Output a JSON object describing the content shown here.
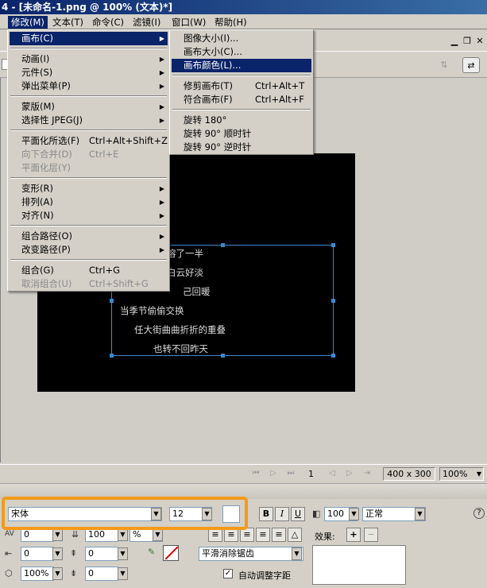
{
  "title": "4 - [未命名-1.png @ 100% (文本)*]",
  "menubar": [
    "修改(M)",
    "文本(T)",
    "命令(C)",
    "滤镜(I)",
    "窗口(W)",
    "帮助(H)"
  ],
  "modify_menu": {
    "items": [
      {
        "label": "画布(C)",
        "submenu": true
      },
      {
        "label": "动画(I)",
        "submenu": true
      },
      {
        "label": "元件(S)",
        "submenu": true
      },
      {
        "label": "弹出菜单(P)",
        "submenu": true
      },
      {
        "label": "蒙版(M)",
        "submenu": true
      },
      {
        "label": "选择性 JPEG(J)",
        "submenu": true
      },
      {
        "label": "平面化所选(F)",
        "shortcut": "Ctrl+Alt+Shift+Z"
      },
      {
        "label": "向下合并(D)",
        "shortcut": "Ctrl+E"
      },
      {
        "label": "平面化层(Y)"
      },
      {
        "label": "变形(R)",
        "submenu": true
      },
      {
        "label": "排列(A)",
        "submenu": true
      },
      {
        "label": "对齐(N)",
        "submenu": true
      },
      {
        "label": "组合路径(O)",
        "submenu": true
      },
      {
        "label": "改变路径(P)",
        "submenu": true
      },
      {
        "label": "组合(G)",
        "shortcut": "Ctrl+G"
      },
      {
        "label": "取消组合(U)",
        "shortcut": "Ctrl+Shift+G"
      }
    ]
  },
  "canvas_menu": {
    "items": [
      {
        "label": "图像大小(I)..."
      },
      {
        "label": "画布大小(C)..."
      },
      {
        "label": "画布颜色(L)..."
      },
      {
        "label": "修剪画布(T)",
        "shortcut": "Ctrl+Alt+T"
      },
      {
        "label": "符合画布(F)",
        "shortcut": "Ctrl+Alt+F"
      },
      {
        "label": "旋转 180°"
      },
      {
        "label": "旋转 90° 顺时针"
      },
      {
        "label": "旋转 90° 逆时针"
      }
    ]
  },
  "poem": [
    "溶了一半",
    "白云好淡",
    "己回暖",
    "当季节偷偷交换",
    "任大街曲曲折折的重叠",
    "也转不回昨天"
  ],
  "statusbar": {
    "page": "1",
    "size": "400 x 300",
    "zoom": "100%"
  },
  "properties": {
    "font": "宋体",
    "font_size": "12",
    "bold": "B",
    "italic": "I",
    "underline": "U",
    "opacity": "100",
    "blend_mode": "正常",
    "kerning": "0",
    "leading": "100",
    "leading_unit": "%",
    "indent": "0",
    "space_before": "0",
    "horizontal_scale": "100%",
    "space_after": "0",
    "baseline": "0",
    "antialias": "平滑消除锯齿",
    "auto_kern_label": "自动调整字距",
    "effects_label": "效果:",
    "help": "?"
  },
  "colors": {
    "selection": "#0a246a",
    "textbox_border": "#3a8ad0",
    "highlight": "#f39a1a"
  }
}
